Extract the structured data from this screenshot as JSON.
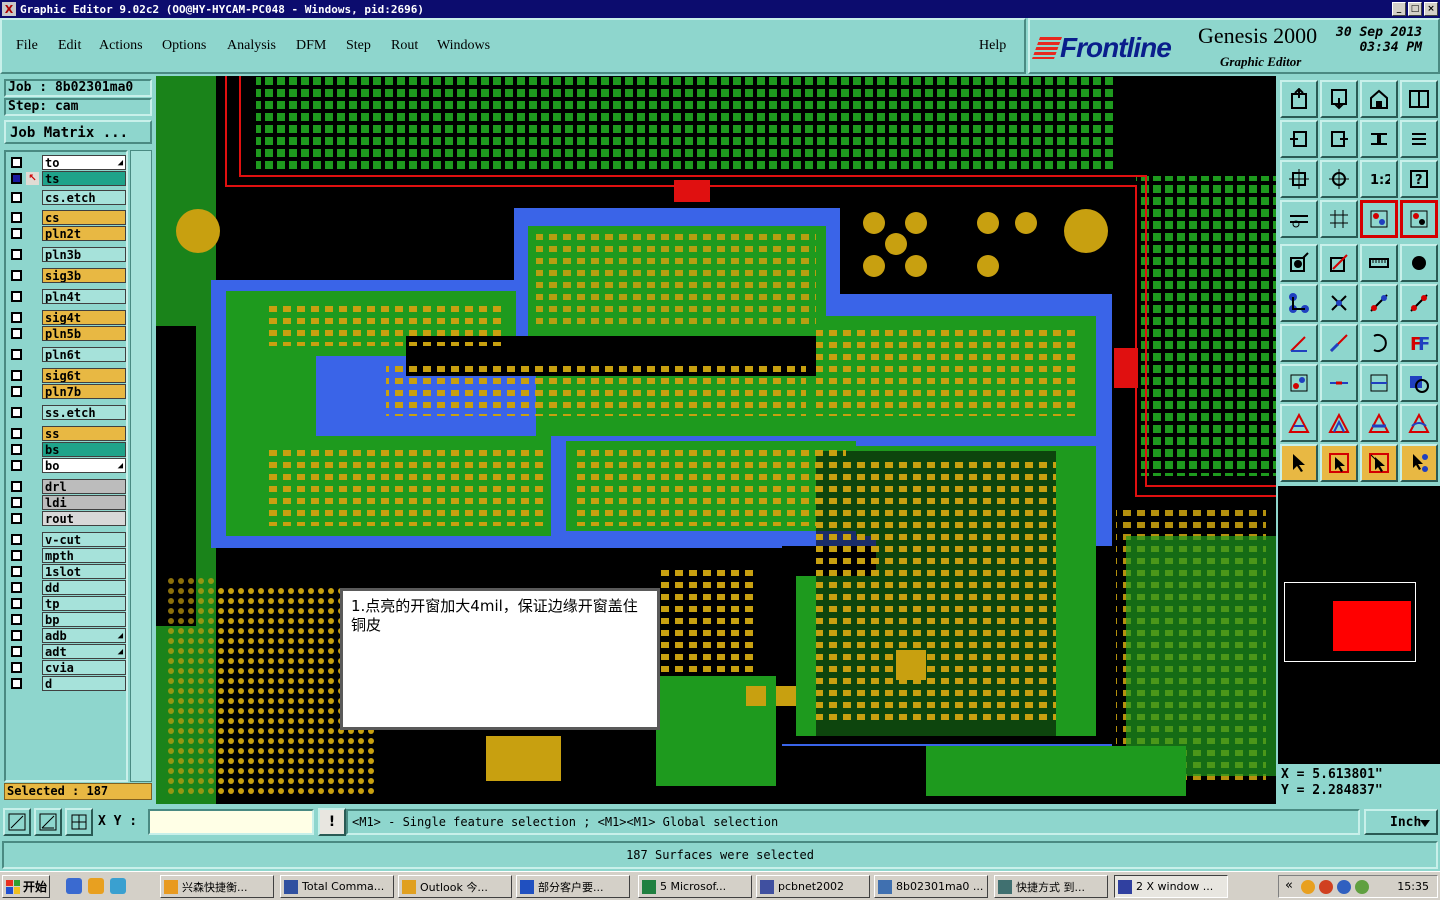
{
  "window": {
    "title": "Graphic Editor 9.02c2 (OO@HY-HYCAM-PC048 - Windows, pid:2696)",
    "close_glyph": "X"
  },
  "menu": [
    "File",
    "Edit",
    "Actions",
    "Options",
    "Analysis",
    "DFM",
    "Step",
    "Rout",
    "Windows"
  ],
  "help": "Help",
  "brand": {
    "logo": "Frontline",
    "product": "Genesis 2000",
    "subtitle": "Graphic Editor",
    "date": "30 Sep 2013",
    "time": "03:34 PM"
  },
  "job": {
    "job_line": "Job : 8b02301ma0",
    "step_line": "Step: cam",
    "matrix_button": "Job Matrix ..."
  },
  "layers": [
    {
      "name": "to",
      "color": "#ffffff",
      "arrow": true
    },
    {
      "name": "ts",
      "color": "#1fa38a",
      "selected": true
    },
    {
      "name": "cs.etch",
      "color": "#a6e2da"
    },
    {
      "name": "cs",
      "color": "#e8b843"
    },
    {
      "name": "pln2t",
      "color": "#e8b843"
    },
    {
      "name": "pln3b",
      "color": "#a6e2da"
    },
    {
      "name": "sig3b",
      "color": "#e8b843"
    },
    {
      "name": "pln4t",
      "color": "#a6e2da"
    },
    {
      "name": "sig4t",
      "color": "#e8b843"
    },
    {
      "name": "pln5b",
      "color": "#e8b843"
    },
    {
      "name": "pln6t",
      "color": "#a6e2da"
    },
    {
      "name": "sig6t",
      "color": "#e8b843"
    },
    {
      "name": "pln7b",
      "color": "#e8b843"
    },
    {
      "name": "ss.etch",
      "color": "#a6e2da"
    },
    {
      "name": "ss",
      "color": "#e8b843"
    },
    {
      "name": "bs",
      "color": "#1fa38a"
    },
    {
      "name": "bo",
      "color": "#ffffff",
      "arrow": true
    },
    {
      "name": "drl",
      "color": "#bcbcbc"
    },
    {
      "name": "ldi",
      "color": "#bcbcbc"
    },
    {
      "name": "rout",
      "color": "#d8d8d8"
    },
    {
      "name": "v-cut",
      "color": "#a6e2da"
    },
    {
      "name": "mpth",
      "color": "#a6e2da"
    },
    {
      "name": "1slot",
      "color": "#a6e2da"
    },
    {
      "name": "dd",
      "color": "#a6e2da"
    },
    {
      "name": "tp",
      "color": "#a6e2da"
    },
    {
      "name": "bp",
      "color": "#a6e2da"
    },
    {
      "name": "adb",
      "color": "#a6e2da",
      "arrow": true
    },
    {
      "name": "adt",
      "color": "#a6e2da",
      "arrow": true
    },
    {
      "name": "cvia",
      "color": "#a6e2da"
    },
    {
      "name": "d",
      "color": "#a6e2da"
    }
  ],
  "selected": "Selected : 187",
  "note": "1.点亮的开窗加大4mil，保证边缘开窗盖住铜皮",
  "toolbox_icons": [
    "move-layer-up-icon",
    "move-layer-down-icon",
    "home-icon",
    "window-split-icon",
    "zoom-left-icon",
    "zoom-right-icon",
    "pan-icon",
    "redraw-icon",
    "zoom-fit-icon",
    "zoom-center-icon",
    "scale-1to2-icon",
    "help-icon",
    "measure-icon",
    "grid-icon",
    "snap-icon",
    "snap-active-icon",
    "add-pad-icon",
    "add-line-icon",
    "ruler-icon",
    "record-icon",
    "connect-icon",
    "cross-icon",
    "select-line-icon",
    "select-feature-icon",
    "angle-icon",
    "draw-line-icon",
    "arc-icon",
    "text-font-icon",
    "select-point-icon",
    "divide-icon",
    "zoom-box-icon",
    "overlap-icon",
    "triangle-icon",
    "delta-icon",
    "polygon-icon",
    "polyline-icon",
    "pointer-icon",
    "pointer-select-icon",
    "pointer-move-icon",
    "pointer-node-icon"
  ],
  "coords": {
    "x": "X = 5.613801\"",
    "y": "Y = 2.284837\""
  },
  "cmd": {
    "xy_label": "X Y :",
    "xy_value": "",
    "hint": "<M1> - Single feature selection ; <M1><M1> Global selection",
    "units": "Inch",
    "warn": "!"
  },
  "status": "187 Surfaces were selected",
  "taskbar": {
    "start": "开始",
    "tasks": [
      {
        "label": "兴森快捷衡...",
        "color": "#e89a20"
      },
      {
        "label": "Total Comma...",
        "color": "#3050a0"
      },
      {
        "label": "Outlook 今...",
        "color": "#e0a020"
      },
      {
        "label": "部分客户要...",
        "color": "#2050c0"
      },
      {
        "label": "5 Microsof...",
        "color": "#208040"
      },
      {
        "label": "pcbnet2002",
        "color": "#4050a0"
      },
      {
        "label": "8b02301ma0 ...",
        "color": "#4070b0"
      },
      {
        "label": "快捷方式 到...",
        "color": "#407070"
      },
      {
        "label": "2 X window ...",
        "color": "#3040a0"
      }
    ],
    "clock": "15:35"
  }
}
